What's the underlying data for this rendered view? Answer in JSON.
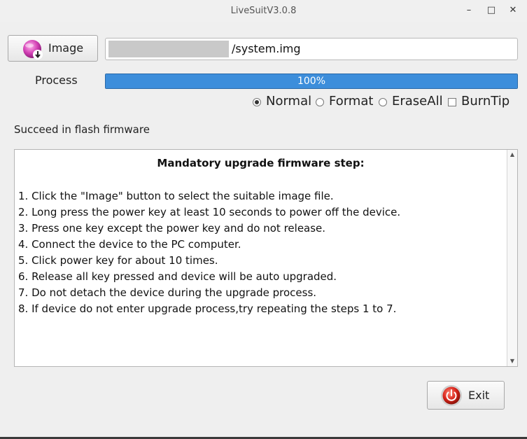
{
  "window": {
    "title": "LiveSuitV3.0.8",
    "minimize_glyph": "–",
    "maximize_glyph": "□",
    "close_glyph": "✕"
  },
  "image_button": {
    "label": "Image",
    "icon": "image-folder-icon"
  },
  "image_path": {
    "value": "/system.img"
  },
  "process": {
    "label": "Process",
    "progress_percent": 100,
    "progress_text": "100%",
    "fill_color": "#3d8edb"
  },
  "options": {
    "normal": {
      "label": "Normal",
      "checked": true
    },
    "format": {
      "label": "Format",
      "checked": false
    },
    "eraseall": {
      "label": "EraseAll",
      "checked": false
    },
    "burntip": {
      "label": "BurnTip",
      "checked": false
    }
  },
  "status": {
    "text": "Succeed in flash firmware"
  },
  "instructions": {
    "heading": "Mandatory upgrade firmware step:",
    "steps": [
      "1. Click the \"Image\" button to select the suitable image file.",
      "2. Long press the power key at least 10 seconds to power off the device.",
      "3. Press one key except the power key and do not release.",
      "4. Connect the device to the PC computer.",
      "5. Click power key for about 10 times.",
      "6. Release all key pressed and device will be auto upgraded.",
      "7. Do not detach the device during the upgrade process.",
      "8. If device do not enter upgrade process,try repeating the steps 1 to 7."
    ]
  },
  "exit_button": {
    "label": "Exit",
    "icon": "exit-power-icon"
  }
}
